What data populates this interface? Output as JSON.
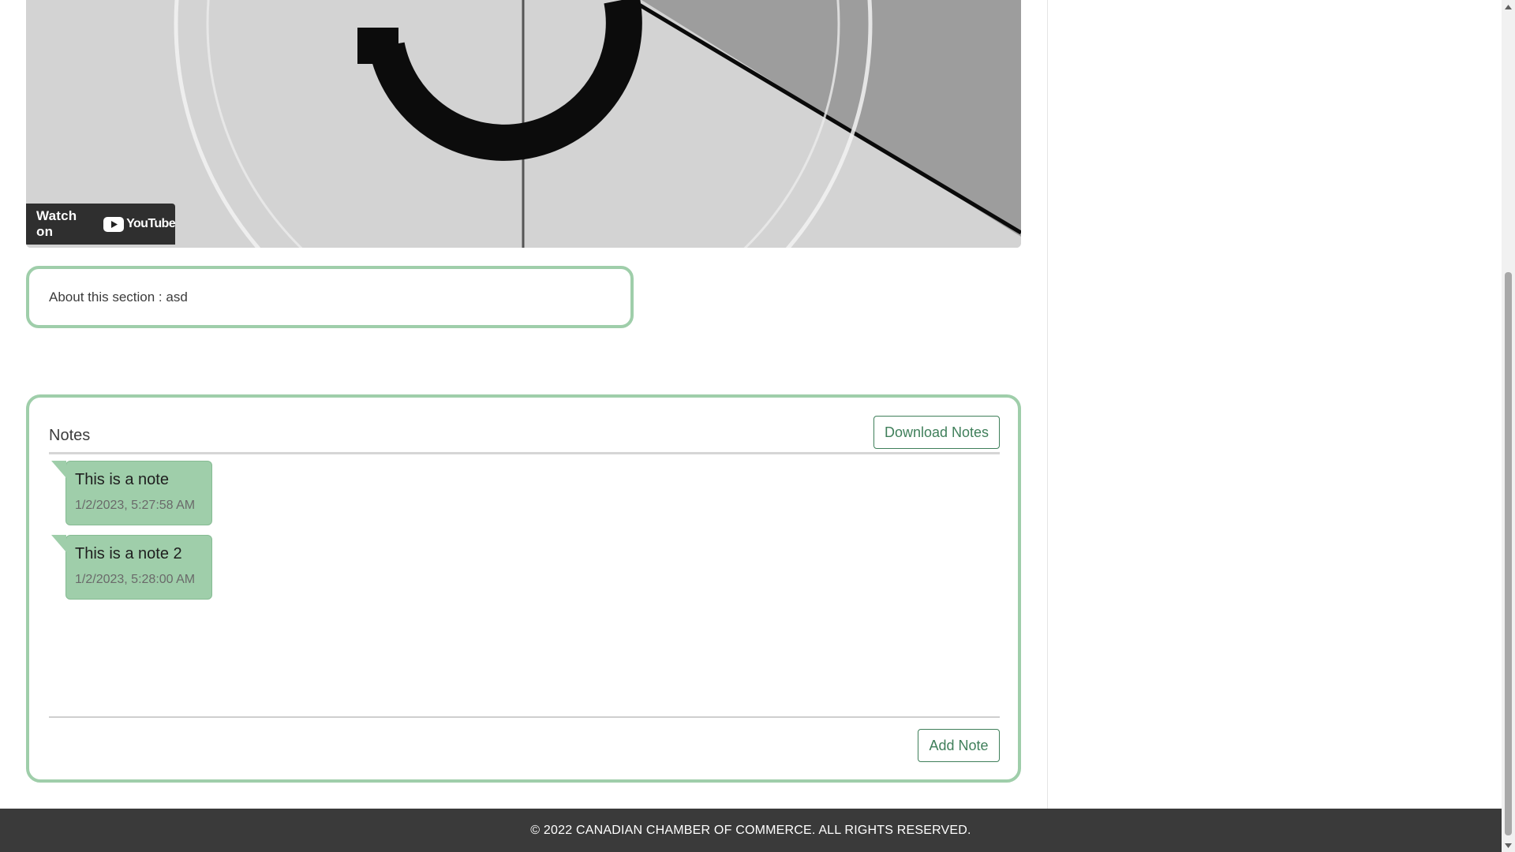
{
  "video": {
    "watch_on_label": "Watch on",
    "youtube_label": "YouTube",
    "youtube_red": "#ff0000"
  },
  "about": {
    "text": "About this section : asd"
  },
  "notes": {
    "title": "Notes",
    "download_label": "Download Notes",
    "add_label": "Add Note",
    "items": [
      {
        "text": "This is a note",
        "time": "1/2/2023, 5:27:58 AM"
      },
      {
        "text": "This is a note 2",
        "time": "1/2/2023, 5:28:00 AM"
      }
    ]
  },
  "footer": {
    "text": "© 2022 CANADIAN CHAMBER OF COMMERCE. ALL RIGHTS RESERVED."
  },
  "colors": {
    "card_border": "#9fceaa",
    "note_bg": "#9fceaa",
    "button_text": "#3f7f5a",
    "footer_bg": "#3a3a3a"
  },
  "icons": {
    "scroll_up": "chevron-up-icon",
    "scroll_down": "chevron-down-icon",
    "youtube": "youtube-play-icon"
  }
}
